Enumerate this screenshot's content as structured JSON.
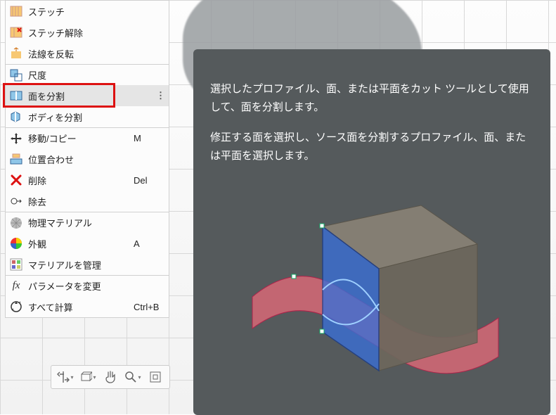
{
  "menu": {
    "items": [
      {
        "label": "ステッチ",
        "shortcut": "",
        "sep": false,
        "hl": false,
        "icon": "stitch-icon"
      },
      {
        "label": "ステッチ解除",
        "shortcut": "",
        "sep": false,
        "hl": false,
        "icon": "unstitch-icon"
      },
      {
        "label": "法線を反転",
        "shortcut": "",
        "sep": false,
        "hl": false,
        "icon": "flip-normal-icon"
      },
      {
        "label": "尺度",
        "shortcut": "",
        "sep": true,
        "hl": false,
        "icon": "scale-icon"
      },
      {
        "label": "面を分割",
        "shortcut": "",
        "sep": false,
        "hl": true,
        "icon": "split-face-icon",
        "dots": true
      },
      {
        "label": "ボディを分割",
        "shortcut": "",
        "sep": false,
        "hl": false,
        "icon": "split-body-icon"
      },
      {
        "label": "移動/コピー",
        "shortcut": "M",
        "sep": true,
        "hl": false,
        "icon": "move-icon"
      },
      {
        "label": "位置合わせ",
        "shortcut": "",
        "sep": false,
        "hl": false,
        "icon": "align-icon"
      },
      {
        "label": "削除",
        "shortcut": "Del",
        "sep": false,
        "hl": false,
        "icon": "delete-icon"
      },
      {
        "label": "除去",
        "shortcut": "",
        "sep": false,
        "hl": false,
        "icon": "remove-icon"
      },
      {
        "label": "物理マテリアル",
        "shortcut": "",
        "sep": true,
        "hl": false,
        "icon": "phys-material-icon"
      },
      {
        "label": "外観",
        "shortcut": "A",
        "sep": false,
        "hl": false,
        "icon": "appearance-icon"
      },
      {
        "label": "マテリアルを管理",
        "shortcut": "",
        "sep": false,
        "hl": false,
        "icon": "manage-material-icon"
      },
      {
        "label": "パラメータを変更",
        "shortcut": "",
        "sep": true,
        "hl": false,
        "icon": "fx-icon"
      },
      {
        "label": "すべて計算",
        "shortcut": "Ctrl+B",
        "sep": false,
        "hl": false,
        "icon": "compute-all-icon"
      }
    ]
  },
  "tooltip": {
    "p1": "選択したプロファイル、面、または平面をカット ツールとして使用して、面を分割します。",
    "p2": "修正する面を選択し、ソース面を分割するプロファイル、面、または平面を選択します。"
  },
  "nav": {
    "orbit": "⟲",
    "pan": "✥",
    "look": "👁",
    "zoom": "🔍",
    "fit": "⛶"
  }
}
